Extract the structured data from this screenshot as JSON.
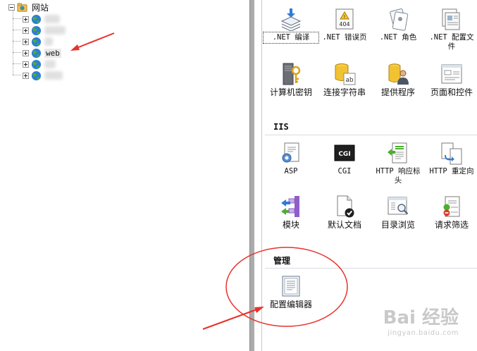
{
  "tree": {
    "root_label": "网站",
    "sites": [
      {
        "label": "",
        "blurred": true,
        "blur_width": 22
      },
      {
        "label": "",
        "blurred": true,
        "blur_width": 30
      },
      {
        "label": "",
        "blurred": true,
        "blur_width": 12
      },
      {
        "label": "web",
        "blurred": false,
        "selected": true
      },
      {
        "label": "",
        "blurred": true,
        "blur_width": 16
      },
      {
        "label": "",
        "blurred": true,
        "blur_width": 26
      }
    ]
  },
  "features": {
    "aspnet_items": [
      {
        "label": ".NET 编译",
        "icon": "compile-icon",
        "mono": true,
        "selected": true
      },
      {
        "label": ".NET 错误页",
        "icon": "error-page-404-icon",
        "mono": true
      },
      {
        "label": ".NET 角色",
        "icon": "roles-icon",
        "mono": true
      },
      {
        "label": ".NET 配置文\n件",
        "icon": "profile-icon",
        "mono": true
      },
      {
        "label": "计算机密钥",
        "icon": "machine-key-icon"
      },
      {
        "label": "连接字符串",
        "icon": "connection-string-icon"
      },
      {
        "label": "提供程序",
        "icon": "providers-icon"
      },
      {
        "label": "页面和控件",
        "icon": "pages-controls-icon"
      }
    ],
    "iis_title": "IIS",
    "iis_items": [
      {
        "label": "ASP",
        "icon": "asp-icon",
        "mono": true
      },
      {
        "label": "CGI",
        "icon": "cgi-icon",
        "mono": true
      },
      {
        "label": "HTTP 响应标\n头",
        "icon": "http-headers-icon",
        "mono": true
      },
      {
        "label": "HTTP 重定向",
        "icon": "http-redirect-icon",
        "mono": true
      },
      {
        "label": "模块",
        "icon": "modules-icon"
      },
      {
        "label": "默认文档",
        "icon": "default-document-icon"
      },
      {
        "label": "目录浏览",
        "icon": "directory-browsing-icon"
      },
      {
        "label": "请求筛选",
        "icon": "request-filtering-icon"
      }
    ],
    "management_title": "管理",
    "management_items": [
      {
        "label": "配置编辑器",
        "icon": "configuration-editor-icon"
      }
    ]
  },
  "watermark": {
    "text": "Bai 经验",
    "sub": "jingyan.baidu.com"
  },
  "colors": {
    "annotation_red": "#e8312b",
    "globe_blue": "#2d7fd3",
    "globe_green": "#4caf2e"
  }
}
